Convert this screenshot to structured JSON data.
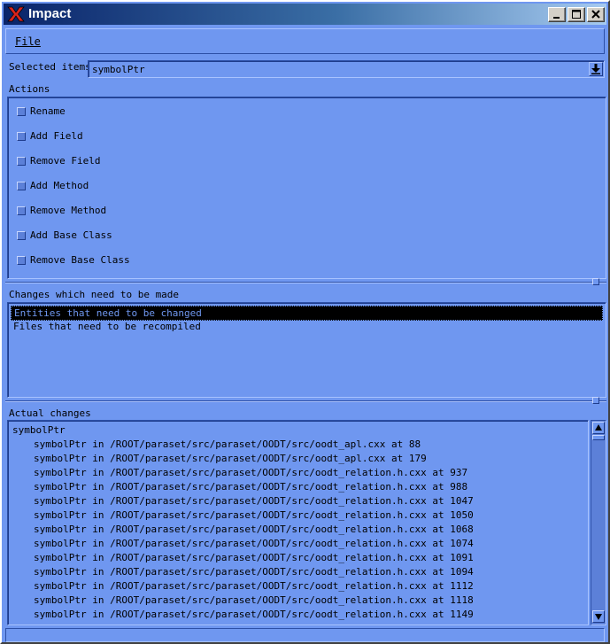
{
  "window": {
    "title": "Impact"
  },
  "menu": {
    "file": "File"
  },
  "selected_items": {
    "label": "Selected items",
    "value": "symbolPtr"
  },
  "actions": {
    "label": "Actions",
    "items": [
      {
        "label": "Rename"
      },
      {
        "label": "Add Field"
      },
      {
        "label": "Remove Field"
      },
      {
        "label": "Add Method"
      },
      {
        "label": "Remove Method"
      },
      {
        "label": "Add Base Class"
      },
      {
        "label": "Remove Base Class"
      }
    ]
  },
  "changes": {
    "label": "Changes which need to be made",
    "items": [
      {
        "label": "Entities that need to be changed",
        "selected": true
      },
      {
        "label": "Files that need to be recompiled",
        "selected": false
      }
    ]
  },
  "actual_changes": {
    "label": "Actual changes",
    "root": "symbolPtr",
    "lines": [
      "symbolPtr in /ROOT/paraset/src/paraset/OODT/src/oodt_apl.cxx at 88",
      "symbolPtr in /ROOT/paraset/src/paraset/OODT/src/oodt_apl.cxx at 179",
      "symbolPtr in /ROOT/paraset/src/paraset/OODT/src/oodt_relation.h.cxx at 937",
      "symbolPtr in /ROOT/paraset/src/paraset/OODT/src/oodt_relation.h.cxx at 988",
      "symbolPtr in /ROOT/paraset/src/paraset/OODT/src/oodt_relation.h.cxx at 1047",
      "symbolPtr in /ROOT/paraset/src/paraset/OODT/src/oodt_relation.h.cxx at 1050",
      "symbolPtr in /ROOT/paraset/src/paraset/OODT/src/oodt_relation.h.cxx at 1068",
      "symbolPtr in /ROOT/paraset/src/paraset/OODT/src/oodt_relation.h.cxx at 1074",
      "symbolPtr in /ROOT/paraset/src/paraset/OODT/src/oodt_relation.h.cxx at 1091",
      "symbolPtr in /ROOT/paraset/src/paraset/OODT/src/oodt_relation.h.cxx at 1094",
      "symbolPtr in /ROOT/paraset/src/paraset/OODT/src/oodt_relation.h.cxx at 1112",
      "symbolPtr in /ROOT/paraset/src/paraset/OODT/src/oodt_relation.h.cxx at 1118",
      "symbolPtr in /ROOT/paraset/src/paraset/OODT/src/oodt_relation.h.cxx at 1149"
    ]
  },
  "icons": {
    "app": "x-logo-icon",
    "minimize": "minimize-icon",
    "maximize": "maximize-icon",
    "close": "close-icon",
    "dropdown": "dropdown-arrow-icon",
    "scroll_up": "scroll-up-icon",
    "scroll_down": "scroll-down-icon"
  },
  "colors": {
    "background": "#6f97f0",
    "titlebar_start": "#0a246a",
    "titlebar_end": "#a6caf0",
    "selection_bg": "#000000"
  }
}
